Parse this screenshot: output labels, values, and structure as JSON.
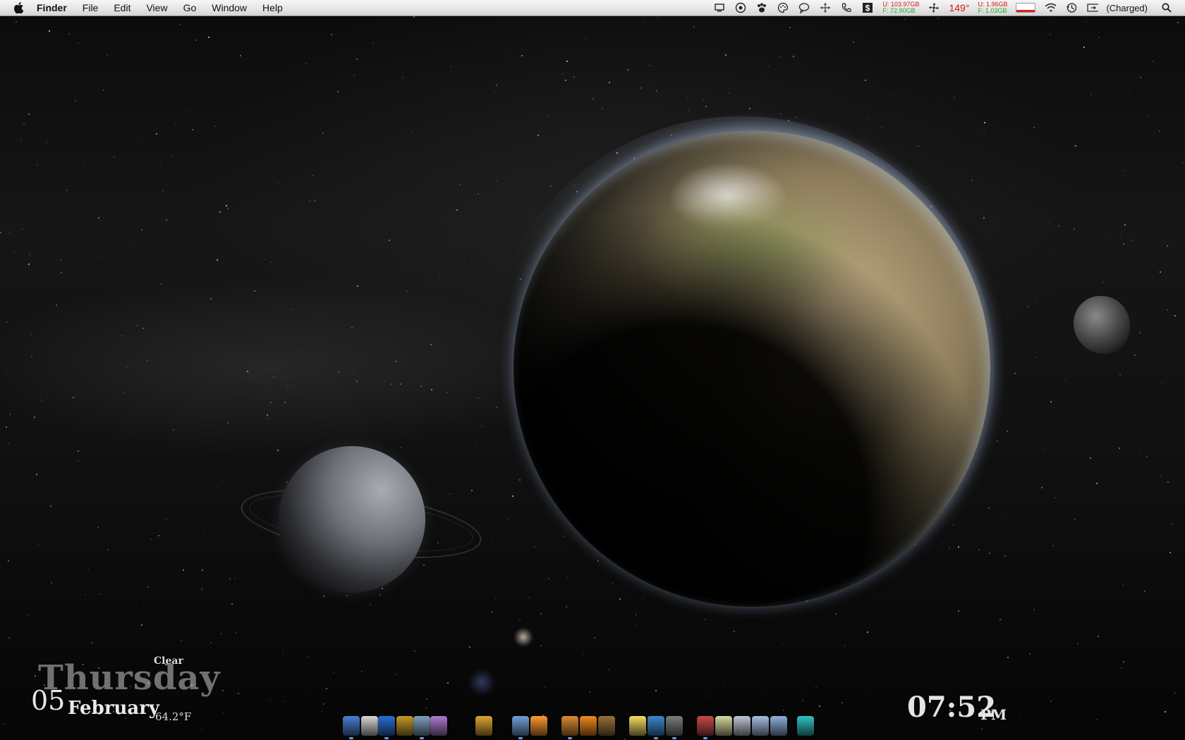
{
  "menubar": {
    "app_name": "Finder",
    "menus": [
      "File",
      "Edit",
      "View",
      "Go",
      "Window",
      "Help"
    ],
    "disk": {
      "used": "U: 103.97GB",
      "free": "F: 72.90GB"
    },
    "temperature": "149°",
    "memory": {
      "used": "U: 1.96GB",
      "free": "F: 1.03GB"
    },
    "battery_status": "(Charged)",
    "icons": [
      "apple-logo",
      "display-icon",
      "gear-badge-icon",
      "paw-icon",
      "palette-icon",
      "speech-bubble-icon",
      "compass-arrows-icon",
      "phone-icon",
      "dollar-icon",
      "fan-icon",
      "battery-meter-icon",
      "wifi-icon",
      "time-machine-icon",
      "battery-icon",
      "spotlight-icon"
    ]
  },
  "date_widget": {
    "weekday": "Thursday",
    "day": "05",
    "month": "February",
    "condition": "Clear",
    "temperature": "64.2°F"
  },
  "clock_widget": {
    "time": "07:52",
    "ampm": "PM"
  },
  "dock": {
    "items": [
      "finder-icon",
      "preview-icon",
      "dashboard-icon",
      "chess-icon",
      "system-prefs-icon",
      "address-icon",
      "burn-icon",
      "itunes-icon",
      "photo-icon",
      "pages-icon",
      "vlc-icon",
      "screenshot-icon",
      "notes-icon",
      "app-icon-1",
      "app-icon-2",
      "app-icon-3",
      "documents-stack-icon",
      "downloads-stack-icon",
      "folder-stack-icon",
      "applications-stack-icon",
      "trash-icon"
    ],
    "colors": [
      "#4a7fd6",
      "#d9d9d9",
      "#2b6fd1",
      "#c69a2a",
      "#7fa0c0",
      "#b07ad0",
      "#e0a531",
      "#6fa2d9",
      "#ff9a2e",
      "#d98c2e",
      "#f08a1c",
      "#9a6f3a",
      "#f5de64",
      "#3a8ad0",
      "#7d7d7d",
      "#c94a4a",
      "#d9d9a0",
      "#bfc7d6",
      "#a9c0e0",
      "#8fb1d9",
      "#2fc4c4"
    ]
  },
  "colors": {
    "menubar_bg": "#e6e6e6",
    "disk_used": "#d41818",
    "disk_free": "#2aa52a"
  }
}
